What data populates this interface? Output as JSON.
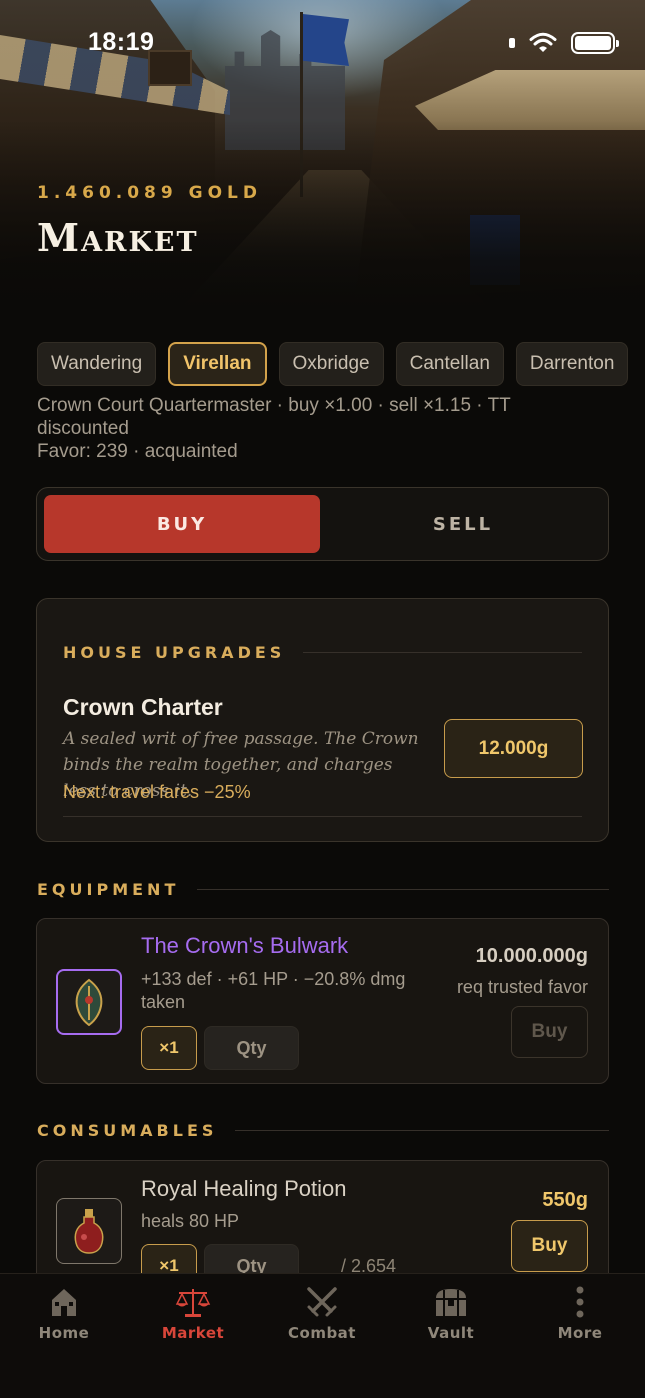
{
  "status_bar": {
    "time": "18:19"
  },
  "header": {
    "gold": "1.460.089 GOLD",
    "title": "Market"
  },
  "town_tabs": [
    {
      "label": "Wandering",
      "active": false
    },
    {
      "label": "Virellan",
      "active": true
    },
    {
      "label": "Oxbridge",
      "active": false
    },
    {
      "label": "Cantellan",
      "active": false
    },
    {
      "label": "Darrenton",
      "active": false
    }
  ],
  "merchant": {
    "line1": "Crown Court Quartermaster · buy ×1.00 · sell ×1.15 · TT discounted",
    "line2": "Favor: 239 · acquainted"
  },
  "mode_toggle": {
    "buy_label": "BUY",
    "sell_label": "SELL",
    "selected": "buy"
  },
  "house_upgrades": {
    "heading": "HOUSE UPGRADES",
    "name": "Crown Charter",
    "description": "A sealed writ of free passage. The Crown binds the realm together, and charges less to cross it.",
    "next": "Next: travel fares −25%",
    "price": "12.000g"
  },
  "equipment": {
    "heading": "EQUIPMENT",
    "items": [
      {
        "name": "The Crown's Bulwark",
        "stats": "+133 def · +61 HP · −20.8% dmg taken",
        "qty_mult": "×1",
        "qty_placeholder": "Qty",
        "price": "10.000.000g",
        "requirement": "req trusted favor",
        "buy_label": "Buy",
        "rarity_color": "#a66cf0"
      }
    ]
  },
  "consumables": {
    "heading": "CONSUMABLES",
    "items": [
      {
        "name": "Royal Healing Potion",
        "stats": "heals 80 HP",
        "qty_mult": "×1",
        "qty_placeholder": "Qty",
        "stock": "/ 2.654",
        "price": "550g",
        "buy_label": "Buy"
      }
    ]
  },
  "bottom_nav": [
    {
      "label": "Home",
      "icon": "house-icon",
      "active": false
    },
    {
      "label": "Market",
      "icon": "scales-icon",
      "active": true
    },
    {
      "label": "Combat",
      "icon": "crossed-swords-icon",
      "active": false
    },
    {
      "label": "Vault",
      "icon": "chest-icon",
      "active": false
    },
    {
      "label": "More",
      "icon": "more-vertical-icon",
      "active": false
    }
  ],
  "colors": {
    "accent_gold": "#d9ad5c",
    "buy_red": "#b7372b",
    "nav_active": "#d8463a",
    "epic_purple": "#a66cf0",
    "background": "#0b0a08"
  }
}
